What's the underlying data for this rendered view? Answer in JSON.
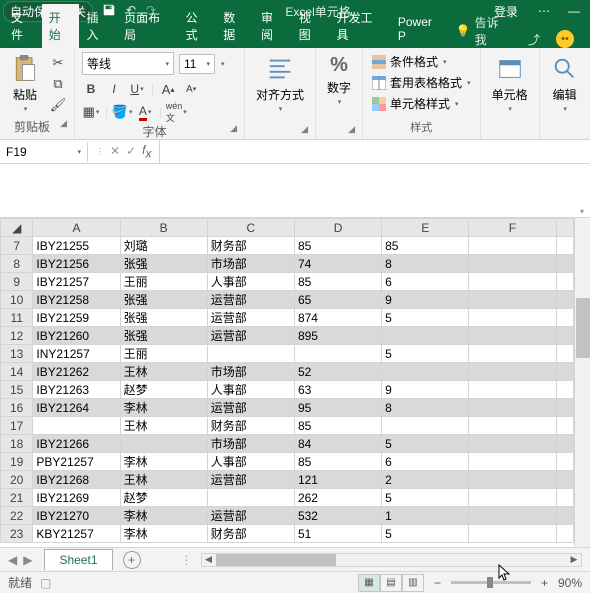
{
  "titlebar": {
    "autosave": "自动保存",
    "autosave_state": "关",
    "title": "Excel单元格...",
    "login": "登录",
    "dots": "⋯",
    "min": "—"
  },
  "tabs": {
    "file": "文件",
    "home": "开始",
    "insert": "插入",
    "layout": "页面布局",
    "formulas": "公式",
    "data": "数据",
    "review": "审阅",
    "view": "视图",
    "developer": "开发工具",
    "powerp": "Power P",
    "tellme": "告诉我"
  },
  "clipboard": {
    "paste": "粘贴",
    "label": "剪贴板"
  },
  "font": {
    "name": "等线",
    "size": "11",
    "label": "字体"
  },
  "align": {
    "label": "对齐方式"
  },
  "number": {
    "label": "数字"
  },
  "styles": {
    "cond": "条件格式",
    "table": "套用表格格式",
    "cell": "单元格样式",
    "label": "样式"
  },
  "cells": {
    "label": "单元格"
  },
  "editing": {
    "label": "编辑"
  },
  "namebox": "F19",
  "sheet": "Sheet1",
  "status": {
    "ready": "就绪",
    "zoom": "90%"
  },
  "colheaders": [
    "A",
    "B",
    "C",
    "D",
    "E",
    "F"
  ],
  "rows": [
    {
      "n": 7,
      "band": 0,
      "c": [
        "IBY21255",
        "刘璐",
        "财务部",
        "85",
        "85",
        ""
      ]
    },
    {
      "n": 8,
      "band": 1,
      "c": [
        "IBY21256",
        "张强",
        "市场部",
        "74",
        "8",
        ""
      ]
    },
    {
      "n": 9,
      "band": 0,
      "c": [
        "IBY21257",
        "王丽",
        "人事部",
        "85",
        "6",
        ""
      ]
    },
    {
      "n": 10,
      "band": 1,
      "c": [
        "IBY21258",
        "张强",
        "运营部",
        "65",
        "9",
        ""
      ]
    },
    {
      "n": 11,
      "band": 0,
      "c": [
        "IBY21259",
        "张强",
        "运营部",
        "874",
        "5",
        ""
      ]
    },
    {
      "n": 12,
      "band": 1,
      "c": [
        "IBY21260",
        "张强",
        "运营部",
        "895",
        "",
        ""
      ]
    },
    {
      "n": 13,
      "band": 0,
      "c": [
        "INY21257",
        "王丽",
        "",
        "",
        "5",
        ""
      ]
    },
    {
      "n": 14,
      "band": 1,
      "c": [
        "IBY21262",
        "王林",
        "市场部",
        "52",
        "",
        ""
      ]
    },
    {
      "n": 15,
      "band": 0,
      "c": [
        "IBY21263",
        "赵梦",
        "人事部",
        "63",
        "9",
        ""
      ]
    },
    {
      "n": 16,
      "band": 1,
      "c": [
        "IBY21264",
        "李林",
        "运营部",
        "95",
        "8",
        ""
      ]
    },
    {
      "n": 17,
      "band": 0,
      "c": [
        "",
        "王林",
        "财务部",
        "85",
        "",
        ""
      ]
    },
    {
      "n": 18,
      "band": 1,
      "c": [
        "IBY21266",
        "",
        "市场部",
        "84",
        "5",
        ""
      ]
    },
    {
      "n": 19,
      "band": 0,
      "c": [
        "PBY21257",
        "李林",
        "人事部",
        "85",
        "6",
        ""
      ]
    },
    {
      "n": 20,
      "band": 1,
      "c": [
        "IBY21268",
        "王林",
        "运营部",
        "121",
        "2",
        ""
      ]
    },
    {
      "n": 21,
      "band": 0,
      "c": [
        "IBY21269",
        "赵梦",
        "",
        "262",
        "5",
        ""
      ]
    },
    {
      "n": 22,
      "band": 1,
      "c": [
        "IBY21270",
        "李林",
        "运营部",
        "532",
        "1",
        ""
      ]
    },
    {
      "n": 23,
      "band": 0,
      "c": [
        "KBY21257",
        "李林",
        "财务部",
        "51",
        "5",
        ""
      ]
    }
  ]
}
